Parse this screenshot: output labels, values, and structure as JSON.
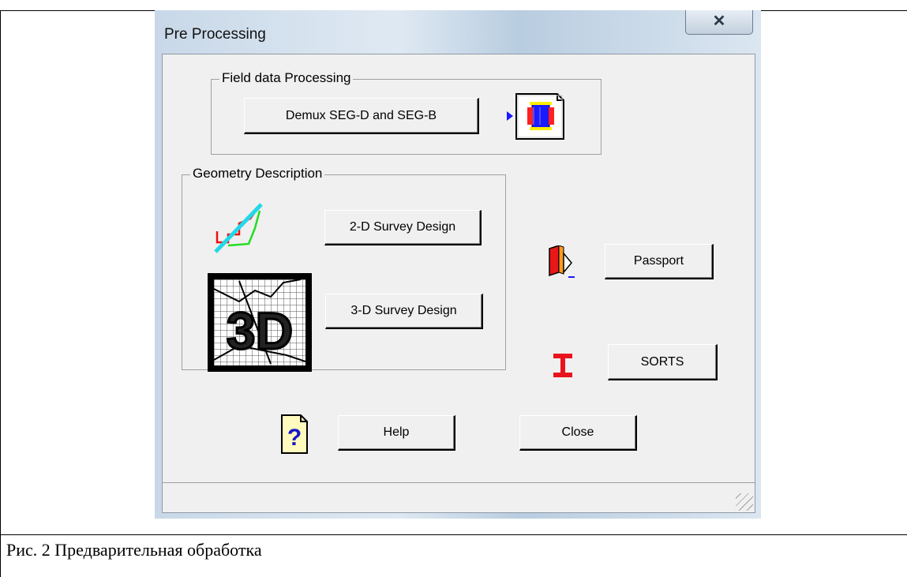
{
  "window": {
    "title": "Pre Processing",
    "close_glyph": "✕"
  },
  "field_data": {
    "group_label": "Field data Processing",
    "demux_button": "Demux SEG-D and SEG-B",
    "demux_icon": "tape-document-icon"
  },
  "geometry": {
    "group_label": "Geometry Description",
    "survey_2d_button": "2-D Survey Design",
    "survey_3d_button": "3-D Survey Design",
    "icon_3d_text": "3D"
  },
  "right_panel": {
    "passport_button": "Passport",
    "sorts_button": "SORTS"
  },
  "bottom": {
    "help_button": "Help",
    "close_button": "Close",
    "help_icon_glyph": "?"
  },
  "caption": "Рис. 2 Предварительная обработка",
  "colors": {
    "accent_red": "#e8131d",
    "help_blue": "#1616c8",
    "title_bg": "#dfe9f3"
  }
}
